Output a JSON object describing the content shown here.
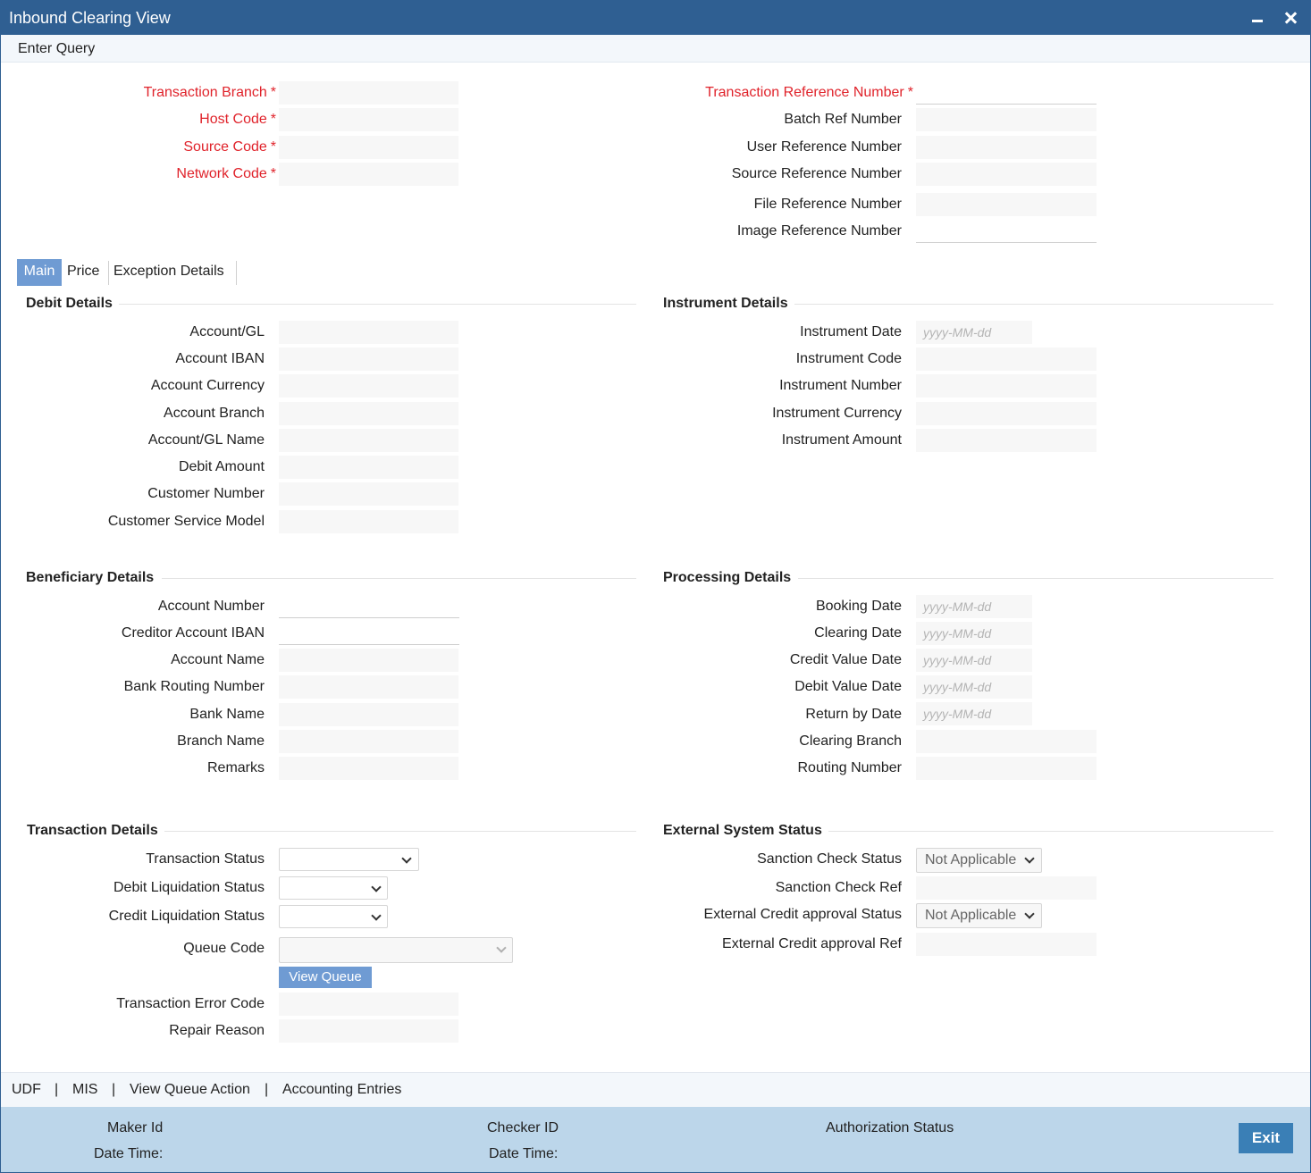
{
  "window": {
    "title": "Inbound Clearing View"
  },
  "toolbar": {
    "enter_query": "Enter Query"
  },
  "header": {
    "left": [
      {
        "label": "Transaction Branch",
        "required": true
      },
      {
        "label": "Host Code",
        "required": true
      },
      {
        "label": "Source Code",
        "required": true
      },
      {
        "label": "Network Code",
        "required": true
      }
    ],
    "right": [
      {
        "label": "Transaction Reference Number",
        "required": true
      },
      {
        "label": "Batch Ref Number"
      },
      {
        "label": "User Reference Number"
      },
      {
        "label": "Source Reference Number"
      },
      {
        "label": "File Reference Number"
      },
      {
        "label": "Image Reference Number"
      }
    ],
    "required_mark": "*"
  },
  "tabs": [
    "Main",
    "Price",
    "Exception Details"
  ],
  "debit": {
    "title": "Debit Details",
    "fields": [
      "Account/GL",
      "Account IBAN",
      "Account Currency",
      "Account Branch",
      "Account/GL Name",
      "Debit Amount",
      "Customer Number",
      "Customer Service Model"
    ]
  },
  "instrument": {
    "title": "Instrument Details",
    "fields": [
      "Instrument Date",
      "Instrument Code",
      "Instrument Number",
      "Instrument Currency",
      "Instrument Amount"
    ]
  },
  "date_placeholder": "yyyy-MM-dd",
  "beneficiary": {
    "title": "Beneficiary Details",
    "fields": [
      "Account Number",
      "Creditor Account IBAN",
      "Account Name",
      "Bank Routing Number",
      "Bank Name",
      "Branch Name",
      "Remarks"
    ]
  },
  "processing": {
    "title": "Processing Details",
    "fields": [
      "Booking Date",
      "Clearing Date",
      "Credit Value Date",
      "Debit Value Date",
      "Return by Date",
      "Clearing Branch",
      "Routing Number"
    ]
  },
  "transaction": {
    "title": "Transaction Details",
    "fields": [
      "Transaction Status",
      "Debit Liquidation Status",
      "Credit Liquidation Status",
      "Queue Code",
      "Transaction Error Code",
      "Repair Reason"
    ],
    "view_queue": "View Queue"
  },
  "external": {
    "title": "External System Status",
    "fields": [
      "Sanction Check Status",
      "Sanction Check Ref",
      "External Credit approval Status",
      "External Credit approval Ref"
    ],
    "sanction_value": "Not Applicable",
    "credit_value": "Not Applicable"
  },
  "footer_links": [
    "UDF",
    "|",
    "MIS",
    "|",
    "View Queue Action",
    "|",
    "Accounting Entries"
  ],
  "status": {
    "maker_id": "Maker Id",
    "maker_dt": "Date Time:",
    "checker_id": "Checker ID",
    "checker_dt": "Date Time:",
    "auth_status": "Authorization Status",
    "exit": "Exit"
  }
}
